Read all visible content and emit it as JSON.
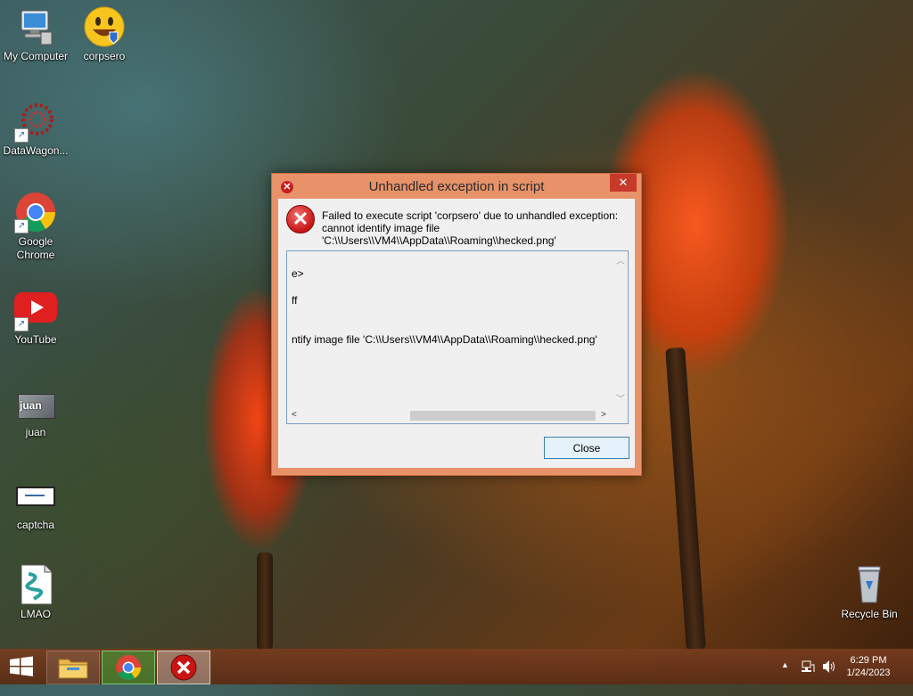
{
  "desktop": {
    "icons": [
      {
        "label": "My Computer"
      },
      {
        "label": "corpsero"
      },
      {
        "label": "DataWagon..."
      },
      {
        "label": "Google Chrome"
      },
      {
        "label": "YouTube"
      },
      {
        "label": "juan"
      },
      {
        "label": "captcha"
      },
      {
        "label": "LMAO"
      },
      {
        "label": "Recycle Bin"
      }
    ],
    "juan_thumb_text": "juan"
  },
  "dialog": {
    "title": "Unhandled exception in script",
    "close_glyph": "✕",
    "message_lines": [
      "Failed to execute script 'corpsero' due to unhandled exception:",
      "cannot identify image file",
      "'C:\\\\Users\\\\VM4\\\\AppData\\\\Roaming\\\\hecked.png'"
    ],
    "details": [
      "e>",
      "ff",
      "ntify image file 'C:\\\\Users\\\\VM4\\\\AppData\\\\Roaming\\\\hecked.png'"
    ],
    "button_label": "Close"
  },
  "taskbar": {
    "time": "6:29 PM",
    "date": "1/24/2023"
  },
  "icons": {
    "start": "windows-logo-icon",
    "explorer": "file-explorer-icon",
    "chrome": "chrome-icon",
    "error": "error-icon"
  },
  "colors": {
    "dialog_frame": "#e8926a",
    "error_red": "#c81414",
    "button_border": "#3c7fb1"
  }
}
